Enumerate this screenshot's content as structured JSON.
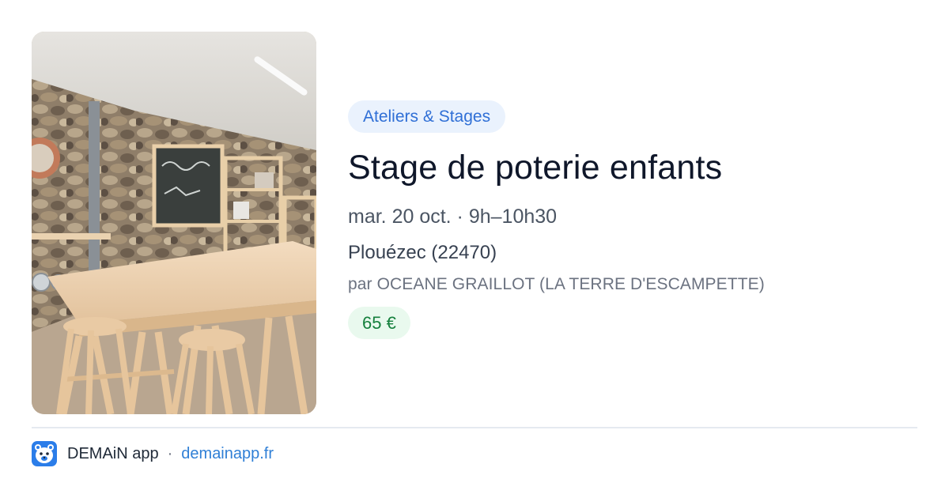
{
  "event": {
    "category": "Ateliers & Stages",
    "title": "Stage de poterie enfants",
    "datetime": "mar. 20 oct. · 9h–10h30",
    "location": "Plouézec (22470)",
    "organizer": "par OCEANE GRAILLOT (LA TERRE D'ESCAMPETTE)",
    "price": "65 €"
  },
  "footer": {
    "app_name": "DEMAiN app",
    "separator": "·",
    "url": "demainapp.fr"
  },
  "colors": {
    "category_text": "#2f6fd6",
    "category_bg": "#eaf2fd",
    "price_text": "#15803d",
    "price_bg": "#e9f9ee",
    "link": "#2f7fd6",
    "logo_blue": "#2b7de9"
  },
  "icons": {
    "app_logo": "demain-bear-logo-icon"
  }
}
